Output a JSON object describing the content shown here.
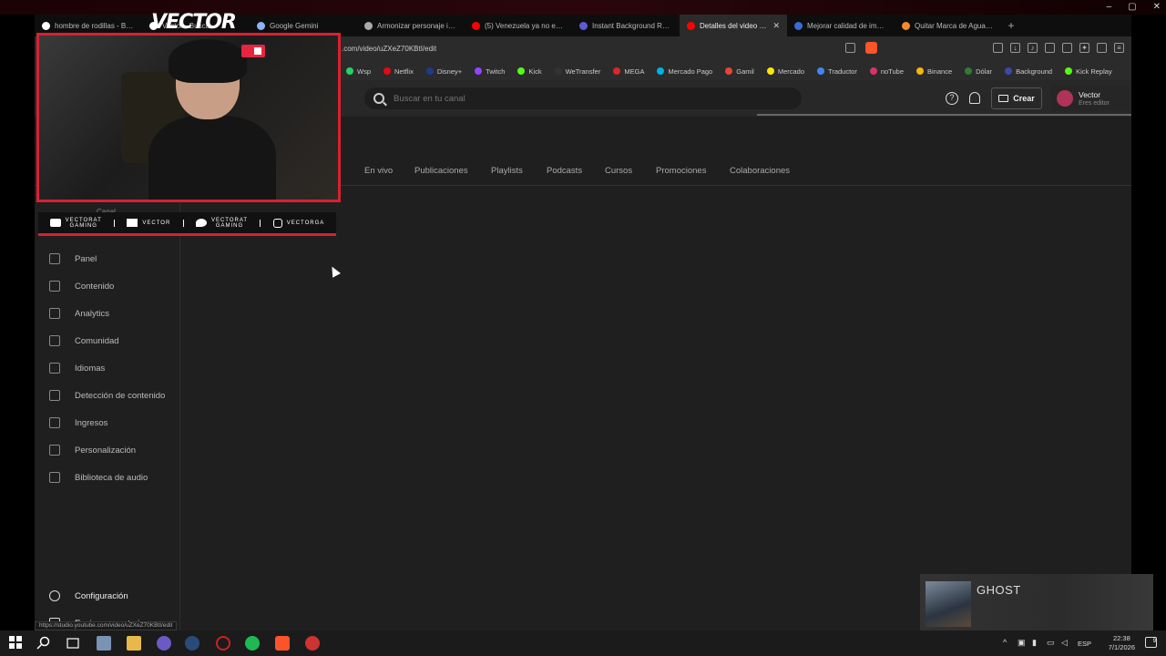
{
  "browser": {
    "tabs": [
      {
        "label": "hombre de rodillas - Busca",
        "color": "#ffffff"
      },
      {
        "label": "Vector - Busca",
        "color": "#ffffff"
      },
      {
        "label": "Google Gemini",
        "color": "#8ab4f8"
      },
      {
        "label": "Armonizar personaje imag",
        "color": "#aaaaaa"
      },
      {
        "label": "(5) Venezuela ya no es con",
        "color": "#ff0000"
      },
      {
        "label": "Instant Background Remo",
        "color": "#5b5bd6"
      },
      {
        "label": "Detalles del video - Yo",
        "color": "#ff0000",
        "active": true
      },
      {
        "label": "Mejorar calidad de imagen",
        "color": "#3a6ad6"
      },
      {
        "label": "Quitar Marca de Agua de",
        "color": "#f48b2a"
      }
    ],
    "url": ".com/video/uZXeZ70KBtI/edit",
    "bookmarks": [
      {
        "label": "Wsp",
        "color": "#25d366"
      },
      {
        "label": "Netflix",
        "color": "#e50914"
      },
      {
        "label": "Disney+",
        "color": "#1f3a8a"
      },
      {
        "label": "Twitch",
        "color": "#9146ff"
      },
      {
        "label": "Kick",
        "color": "#53fc18"
      },
      {
        "label": "WeTransfer",
        "color": "#333333"
      },
      {
        "label": "MEGA",
        "color": "#d9272e"
      },
      {
        "label": "Mercado Pago",
        "color": "#00b1ea"
      },
      {
        "label": "Gamil",
        "color": "#ea4335"
      },
      {
        "label": "Mercado",
        "color": "#ffe600"
      },
      {
        "label": "Traductor",
        "color": "#4285f4"
      },
      {
        "label": "noTube",
        "color": "#d6336c"
      },
      {
        "label": "Binance",
        "color": "#f0b90b"
      },
      {
        "label": "Dólar",
        "color": "#2e7d32"
      },
      {
        "label": "Background",
        "color": "#3949ab"
      },
      {
        "label": "Kick Replay",
        "color": "#53fc18"
      }
    ],
    "status_url": "https://studio.youtube.com/video/uZXeZ70KBtI/edit"
  },
  "studio": {
    "search_placeholder": "Buscar en tu canal",
    "create_label": "Crear",
    "profile_name": "Vector",
    "profile_role": "Eres editor",
    "channel_tabs": [
      "En vivo",
      "Publicaciones",
      "Playlists",
      "Podcasts",
      "Cursos",
      "Promociones",
      "Colaboraciones"
    ],
    "canal_label": "Canal",
    "nav": [
      "Panel",
      "Contenido",
      "Analytics",
      "Comunidad",
      "Idiomas",
      "Detección de contenido",
      "Ingresos",
      "Personalización",
      "Biblioteca de audio"
    ],
    "settings_label": "Configuración",
    "feedback_label": "Enviar comentarios"
  },
  "overlay": {
    "title": "VECTOR",
    "socials": [
      {
        "top": "VECTORAT",
        "bottom": "GAMING"
      },
      {
        "top": "VECTOR",
        "bottom": ""
      },
      {
        "top": "VECTORAT",
        "bottom": "GAMING"
      },
      {
        "top": "VECTORGA",
        "bottom": ""
      }
    ]
  },
  "music": {
    "title": "GHOST"
  },
  "taskbar": {
    "lang": "ESP",
    "time": "22:38",
    "date": "7/1/2026",
    "notifications": "9"
  }
}
